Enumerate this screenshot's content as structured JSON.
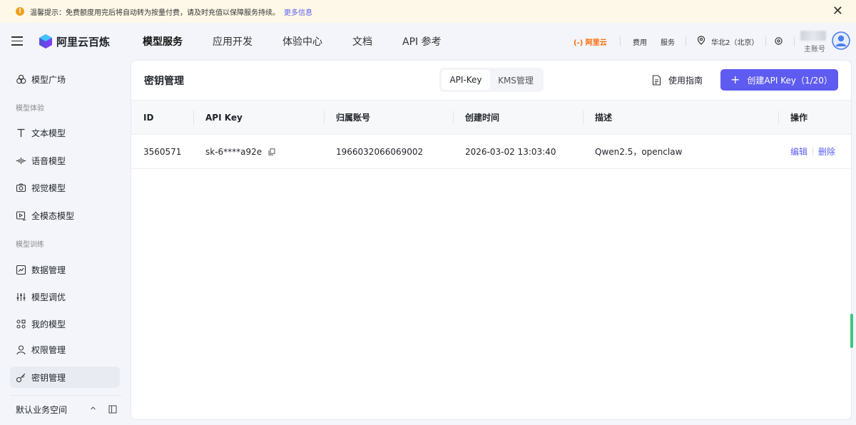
{
  "notice": {
    "icon": "warning-icon",
    "text": "温馨提示：免费额度用完后将自动转为按量付费，请及时充值以保障服务持续。",
    "link": "更多信息"
  },
  "header": {
    "logo_text": "阿里云百炼",
    "nav": [
      "模型服务",
      "应用开发",
      "体验中心",
      "文档",
      "API 参考"
    ],
    "active_nav": "模型服务",
    "brand": "阿里云",
    "links": {
      "billing": "费用",
      "service": "服务"
    },
    "region": "华北2（北京）",
    "account_label": "主账号"
  },
  "sidebar": {
    "top_item": "模型广场",
    "group_experience": "模型体验",
    "experience_items": [
      "文本模型",
      "语音模型",
      "视觉模型",
      "全模态模型"
    ],
    "group_training": "模型训练",
    "training_items": [
      "数据管理",
      "模型调优",
      "我的模型",
      "权限管理",
      "密钥管理"
    ],
    "active_item": "密钥管理",
    "workspace": "默认业务空间"
  },
  "main": {
    "title": "密钥管理",
    "tabs": [
      "API-Key",
      "KMS管理"
    ],
    "active_tab": "API-Key",
    "guide": "使用指南",
    "create_button": "创建API Key（1/20）",
    "accent_color": "#5e5bf0",
    "table": {
      "columns": [
        "ID",
        "API Key",
        "归属账号",
        "创建时间",
        "描述",
        "操作"
      ],
      "rows": [
        {
          "id": "3560571",
          "api_key": "sk-6****a92e",
          "account": "1966032066069002",
          "created": "2026-03-02 13:03:40",
          "description": "Qwen2.5，openclaw",
          "actions": [
            "编辑",
            "删除"
          ]
        }
      ]
    }
  }
}
